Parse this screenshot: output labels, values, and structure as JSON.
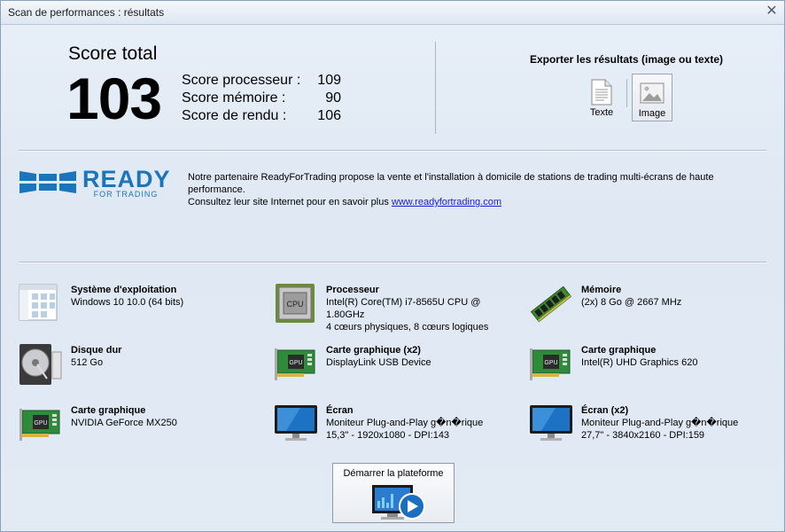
{
  "window": {
    "title": "Scan de performances : résultats"
  },
  "score": {
    "total_label": "Score total",
    "total": "103",
    "rows": [
      {
        "label": "Score processeur :",
        "value": "109"
      },
      {
        "label": "Score mémoire :",
        "value": "90"
      },
      {
        "label": "Score de rendu :",
        "value": "106"
      }
    ]
  },
  "export": {
    "title": "Exporter les résultats (image ou texte)",
    "text_label": "Texte",
    "image_label": "Image"
  },
  "partner": {
    "logo_main": "READY",
    "logo_sub": "FOR TRADING",
    "line1": "Notre partenaire ReadyForTrading propose la vente et l'installation à domicile de stations de trading multi-écrans de haute performance.",
    "line2_prefix": "Consultez leur site Internet pour en savoir plus",
    "link": "www.readyfortrading.com"
  },
  "hardware": [
    {
      "title": "Système d'exploitation",
      "lines": [
        "Windows 10 10.0 (64 bits)",
        ""
      ],
      "icon": "window-icon"
    },
    {
      "title": "Processeur",
      "lines": [
        "Intel(R) Core(TM) i7-8565U CPU @ 1.80GHz",
        "4 cœurs physiques, 8 cœurs logiques"
      ],
      "icon": "cpu-icon",
      "chip_text": "CPU"
    },
    {
      "title": "Mémoire",
      "lines": [
        "(2x) 8 Go @ 2667 MHz",
        ""
      ],
      "icon": "ram-icon"
    },
    {
      "title": "Disque dur",
      "lines": [
        "512 Go",
        ""
      ],
      "icon": "hard-disk-icon"
    },
    {
      "title": "Carte graphique (x2)",
      "lines": [
        "DisplayLink USB Device",
        ""
      ],
      "icon": "gpu-icon",
      "chip_text": "GPU"
    },
    {
      "title": "Carte graphique",
      "lines": [
        "Intel(R) UHD Graphics 620",
        ""
      ],
      "icon": "gpu-icon",
      "chip_text": "GPU"
    },
    {
      "title": "Carte graphique",
      "lines": [
        "NVIDIA GeForce MX250",
        ""
      ],
      "icon": "gpu-icon",
      "chip_text": "GPU"
    },
    {
      "title": "Écran",
      "lines": [
        "Moniteur Plug-and-Play g�n�rique",
        "15,3\" - 1920x1080 - DPI:143"
      ],
      "icon": "monitor-icon"
    },
    {
      "title": "Écran (x2)",
      "lines": [
        "Moniteur Plug-and-Play g�n�rique",
        "27,7\" - 3840x2160 - DPI:159"
      ],
      "icon": "monitor-icon"
    }
  ],
  "start": {
    "label": "Démarrer la plateforme"
  }
}
